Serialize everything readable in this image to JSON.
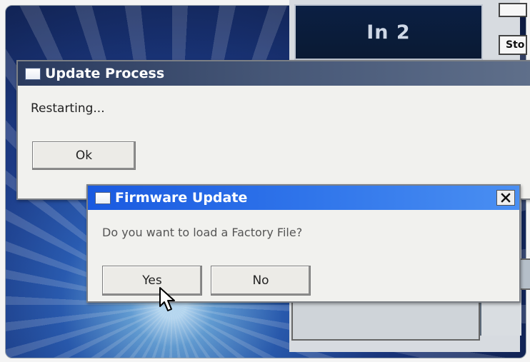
{
  "background_app": {
    "channel_label": "In 2",
    "stop_label": "Sto"
  },
  "update_process": {
    "title": "Update Process",
    "message": "Restarting...",
    "ok_label": "Ok"
  },
  "firmware_update": {
    "title": "Firmware Update",
    "message": "Do you want to load a Factory File?",
    "yes_label": "Yes",
    "no_label": "No",
    "close_icon": "close-icon"
  },
  "colors": {
    "inactive_title": "#3e4f73",
    "active_title": "#2f74ea",
    "dialog_body": "#f1f1ee"
  }
}
